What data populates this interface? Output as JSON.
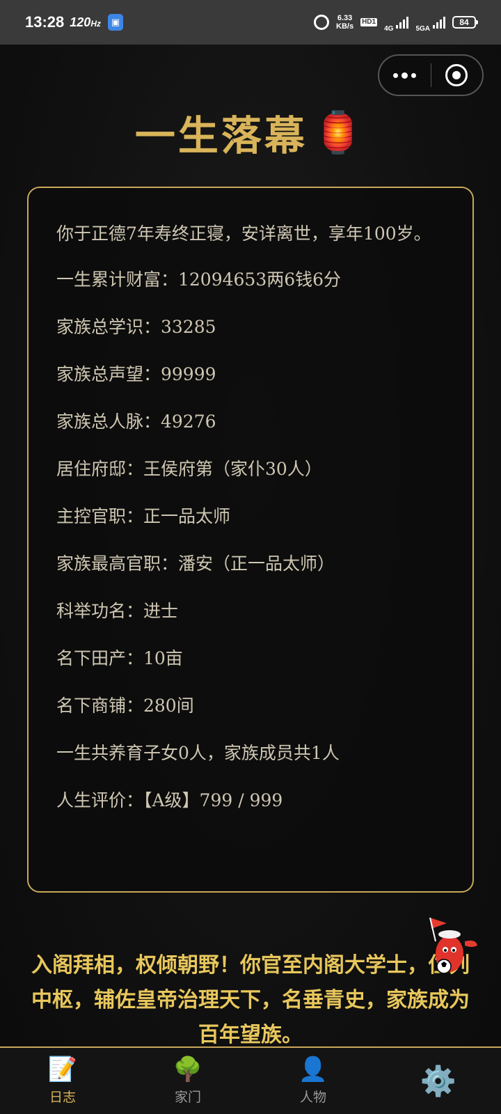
{
  "status_bar": {
    "time": "13:28",
    "refresh": "120",
    "hz_unit": "Hz",
    "speed_value": "6.33",
    "speed_unit": "KB/s",
    "hd1": "HD1",
    "net1": "4G",
    "net2": "5GA",
    "battery": "84"
  },
  "header": {
    "title": "一生落幕",
    "title_emoji": "🏮"
  },
  "summary": {
    "lines": [
      "你于正德7年寿终正寝，安详离世，享年100岁。",
      "一生累计财富：12094653两6钱6分",
      "家族总学识：33285",
      "家族总声望：99999",
      "家族总人脉：49276",
      "居住府邸：王侯府第（家仆30人）",
      "主控官职：正一品太师",
      "家族最高官职：潘安（正一品太师）",
      "科举功名：进士",
      "名下田产：10亩",
      "名下商铺：280间",
      "一生共养育子女0人，家族成员共1人",
      "人生评价：【A级】799 / 999"
    ]
  },
  "ending_text": "入阁拜相，权倾朝野！你官至内阁大学士，位列中枢，辅佐皇帝治理天下，名垂青史，家族成为百年望族。",
  "tabs": [
    {
      "label": "日志",
      "icon": "📝",
      "active": true
    },
    {
      "label": "家门",
      "icon": "🌳",
      "active": false
    },
    {
      "label": "人物",
      "icon": "👤",
      "active": false
    },
    {
      "label": "",
      "icon": "⚙️",
      "active": false
    }
  ],
  "colors": {
    "accent_gold": "#d9b45a",
    "border_gold": "#c9a85a",
    "body_text": "#cfc7b3",
    "ending_text": "#e8c75c",
    "background": "#111111"
  }
}
